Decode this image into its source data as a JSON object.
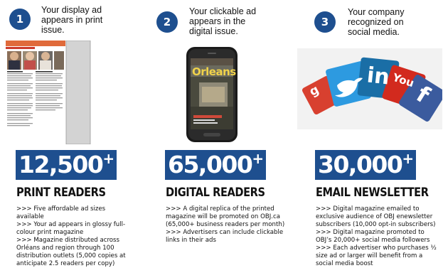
{
  "steps": [
    {
      "number": "1",
      "text": "Your display ad appears in print issue."
    },
    {
      "number": "2",
      "text": "Your clickable ad appears in the digital issue."
    },
    {
      "number": "3",
      "text": "Your company recognized on social media."
    }
  ],
  "phone": {
    "screen_title": "Orleans"
  },
  "social": {
    "icons": [
      "google-plus-icon",
      "twitter-icon",
      "linkedin-icon",
      "youtube-icon",
      "facebook-icon"
    ],
    "labels": {
      "linkedin": "in",
      "youtube": "You",
      "facebook": "f"
    }
  },
  "stats": [
    {
      "number": "12,500",
      "plus": "+",
      "label": "PRINT READERS",
      "bullets": [
        ">>> Five affordable ad sizes available",
        ">>> Your ad appears in glossy full-colour print magazine",
        ">>> Magazine distributed across Orléans and region through 100 distribution outlets (5,000 copies at anticipate 2.5 readers per copy)"
      ]
    },
    {
      "number": "65,000",
      "plus": "+",
      "label": "DIGITAL READERS",
      "bullets": [
        ">>> A digital replica of the printed magazine will be promoted on OBJ.ca (65,000+ business readers per month)",
        ">>> Advertisers can include clickable links in their ads"
      ]
    },
    {
      "number": "30,000",
      "plus": "+",
      "label": "EMAIL NEWSLETTER",
      "bullets": [
        ">>> Digital magazine emailed to exclusive audience of OBJ enewsletter subscribers (10,000 opt-in subscribers)",
        ">>> Digital magazine promoted to OBJ’s 20,000+ social media followers",
        ">>> Each advertiser who purchases ½ size ad or larger will benefit from a social media boost"
      ]
    }
  ],
  "colors": {
    "brand_blue": "#1e4f8f"
  }
}
